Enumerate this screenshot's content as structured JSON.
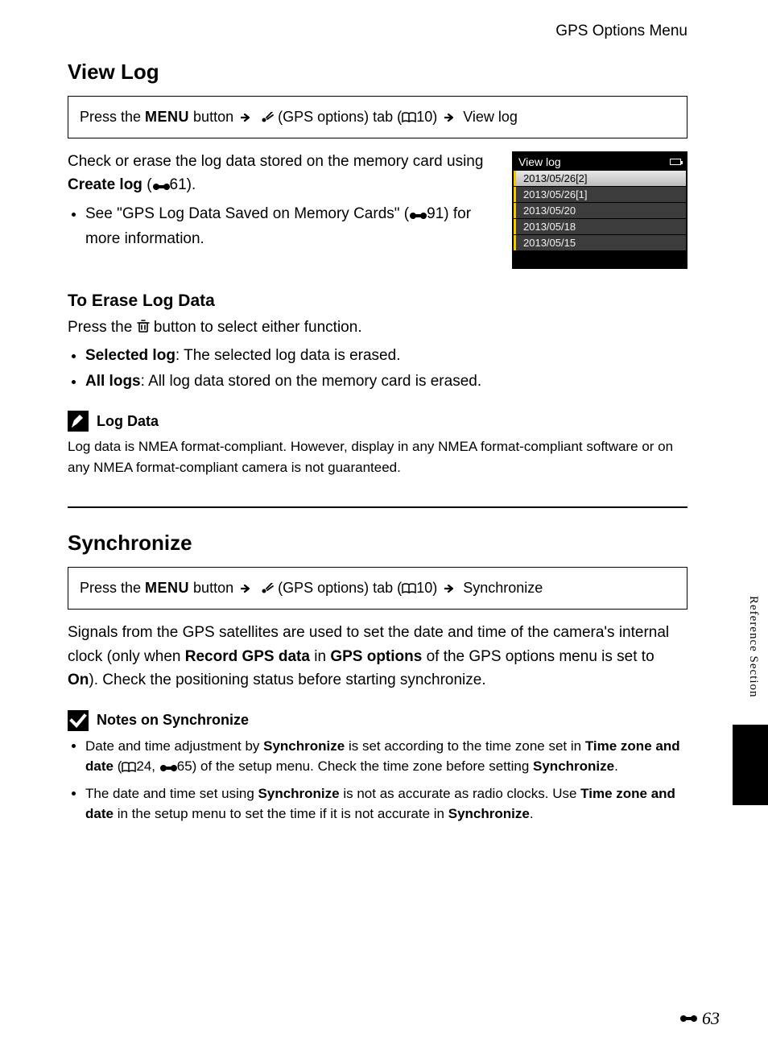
{
  "header": {
    "breadcrumb": "GPS Options Menu"
  },
  "side_label": "Reference Section",
  "page_number": "63",
  "view_log": {
    "title": "View Log",
    "nav": {
      "prefix": "Press the ",
      "menu": "MENU",
      "button_word": " button ",
      "gps_tab": " (GPS options) tab (",
      "page_ref": "10",
      "close": ") ",
      "dest": " View log"
    },
    "intro_1": "Check or erase the log data stored on the memory card using ",
    "intro_bold": "Create log",
    "intro_ref_open": " (",
    "intro_ref_num": "61",
    "intro_ref_close": ").",
    "see_text_1": "See \"GPS Log Data Saved on Memory Cards\" (",
    "see_ref_num": "91",
    "see_text_2": ") for more information.",
    "screenshot": {
      "title": "View log",
      "items": [
        "2013/05/26[2]",
        "2013/05/26[1]",
        "2013/05/20",
        "2013/05/18",
        "2013/05/15"
      ],
      "selected_index": 0
    },
    "erase": {
      "title": "To Erase Log Data",
      "intro_a": "Press the ",
      "intro_b": " button to select either function.",
      "items": [
        {
          "label": "Selected log",
          "desc": ": The selected log data is erased."
        },
        {
          "label": "All logs",
          "desc": ": All log data stored on the memory card is erased."
        }
      ]
    },
    "note": {
      "title": "Log Data",
      "body": "Log data is NMEA format-compliant. However, display in any NMEA format-compliant software or on any NMEA format-compliant camera is not guaranteed."
    }
  },
  "sync": {
    "title": "Synchronize",
    "nav": {
      "prefix": "Press the ",
      "menu": "MENU",
      "button_word": " button ",
      "gps_tab": " (GPS options) tab (",
      "page_ref": "10",
      "close": ") ",
      "dest": " Synchronize"
    },
    "body_1": "Signals from the GPS satellites are used to set the date and time of the camera's internal clock (only when ",
    "body_bold_1": "Record GPS data",
    "body_2": " in ",
    "body_bold_2": "GPS options",
    "body_3": " of the GPS options menu is set to ",
    "body_bold_3": "On",
    "body_4": "). Check the positioning status before starting synchronize.",
    "note": {
      "title": "Notes on Synchronize",
      "items": [
        {
          "p1": "Date and time adjustment by ",
          "b1": "Synchronize",
          "p2": " is set according to the time zone set in ",
          "b2": "Time zone and date",
          "p3_open": " (",
          "ref1": "24",
          "p3_sep": ", ",
          "ref2": "65",
          "p3_close": ") of the setup menu. Check the time zone before setting ",
          "b3": "Synchronize",
          "p4": "."
        },
        {
          "p1": "The date and time set using ",
          "b1": "Synchronize",
          "p2": " is not as accurate as radio clocks. Use ",
          "b2": "Time zone and date",
          "p3": " in the setup menu to set the time if it is not accurate in ",
          "b3": "Synchronize",
          "p4": "."
        }
      ]
    }
  }
}
